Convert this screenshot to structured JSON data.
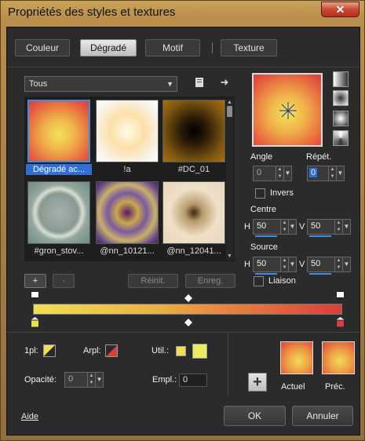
{
  "window": {
    "title": "Propriétés des styles et textures",
    "close": "✕"
  },
  "tabs": [
    "Couleur",
    "Dégradé",
    "Motif",
    "Texture"
  ],
  "category_combo": {
    "value": "Tous"
  },
  "gallery": {
    "items": [
      {
        "label": "Dégradé ac..."
      },
      {
        "label": "!a"
      },
      {
        "label": "#DC_01"
      },
      {
        "label": "#gron_stov..."
      },
      {
        "label": "@nn_10121..."
      },
      {
        "label": "@nn_12041..."
      }
    ]
  },
  "buttons": {
    "add": "+",
    "remove": "-",
    "reset": "Réinit.",
    "save": "Enreg.",
    "ok": "OK",
    "cancel": "Annuler",
    "help": "Aide",
    "add_gradient": "+"
  },
  "controls": {
    "angle_label": "Angle",
    "angle_value": "0",
    "repeat_label": "Répét.",
    "repeat_value": "0",
    "invert_label": "Invers",
    "centre_label": "Centre",
    "centre_h_label": "H",
    "centre_h": "50",
    "centre_v_label": "V",
    "centre_v": "50",
    "source_label": "Source",
    "source_h_label": "H",
    "source_h": "50",
    "source_v_label": "V",
    "source_v": "50",
    "link_label": "Liaison"
  },
  "bottom": {
    "fg_label": "1pl:",
    "bg_label": "Arpl:",
    "user_label": "Util.:",
    "opacity_label": "Opacité:",
    "opacity_value": "0",
    "location_label": "Empl.:",
    "location_value": "0",
    "current_label": "Actuel",
    "previous_label": "Préc."
  },
  "colors": {
    "accent": "#3a8ee6",
    "gradient_start": "#f0df55",
    "gradient_end": "#d83f3a"
  }
}
